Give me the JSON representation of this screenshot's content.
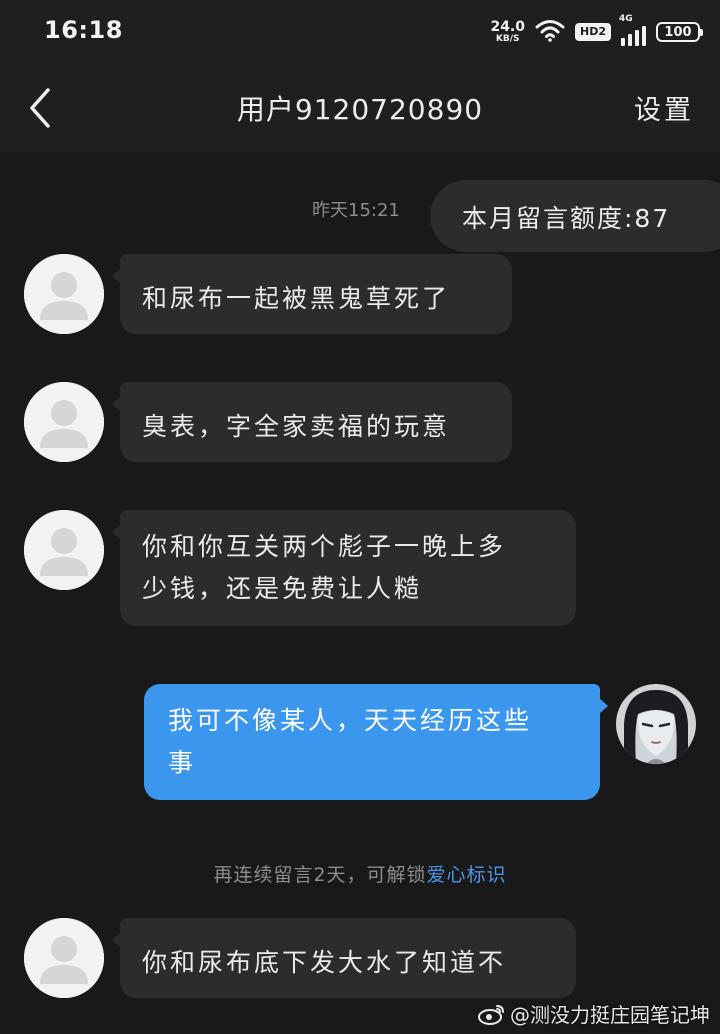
{
  "status_bar": {
    "time": "16:18",
    "net_speed_value": "24.0",
    "net_speed_unit": "KB/S",
    "hd_label": "HD2",
    "network_label": "4G",
    "battery": "100",
    "icons": [
      "wifi-icon",
      "signal-icon",
      "battery-icon"
    ]
  },
  "nav": {
    "back_icon": "chevron-left-icon",
    "title": "用户9120720890",
    "settings_label": "设置"
  },
  "conversation": {
    "timestamp": "昨天15:21",
    "quota_text": "本月留言额度:87",
    "messages": [
      {
        "side": "left",
        "text_lines": [
          "和尿布一起被黑鬼草死了"
        ]
      },
      {
        "side": "left",
        "text_lines": [
          "臭表，字全家卖福的玩意"
        ]
      },
      {
        "side": "left",
        "text_lines": [
          "你和你互关两个彪子一晚上多",
          "少钱，还是免费让人糙"
        ]
      },
      {
        "side": "right",
        "text_lines": [
          "我可不像某人，天天经历这些",
          "事"
        ]
      },
      {
        "side": "left",
        "text_lines": [
          "你和尿布底下发大水了知道不"
        ]
      }
    ],
    "system_tip": {
      "prefix": "再连续留言2天，可解锁",
      "link": "爱心标识"
    }
  },
  "watermark": {
    "icon": "weibo-icon",
    "text": "@测没力挺庄园笔记坤"
  },
  "colors": {
    "background": "#191919",
    "bar_background": "#1f1f1f",
    "incoming_bubble": "#2c2c2c",
    "outgoing_bubble": "#3b97ee",
    "link": "#4c95ea",
    "muted_text": "#8c8c8c"
  }
}
